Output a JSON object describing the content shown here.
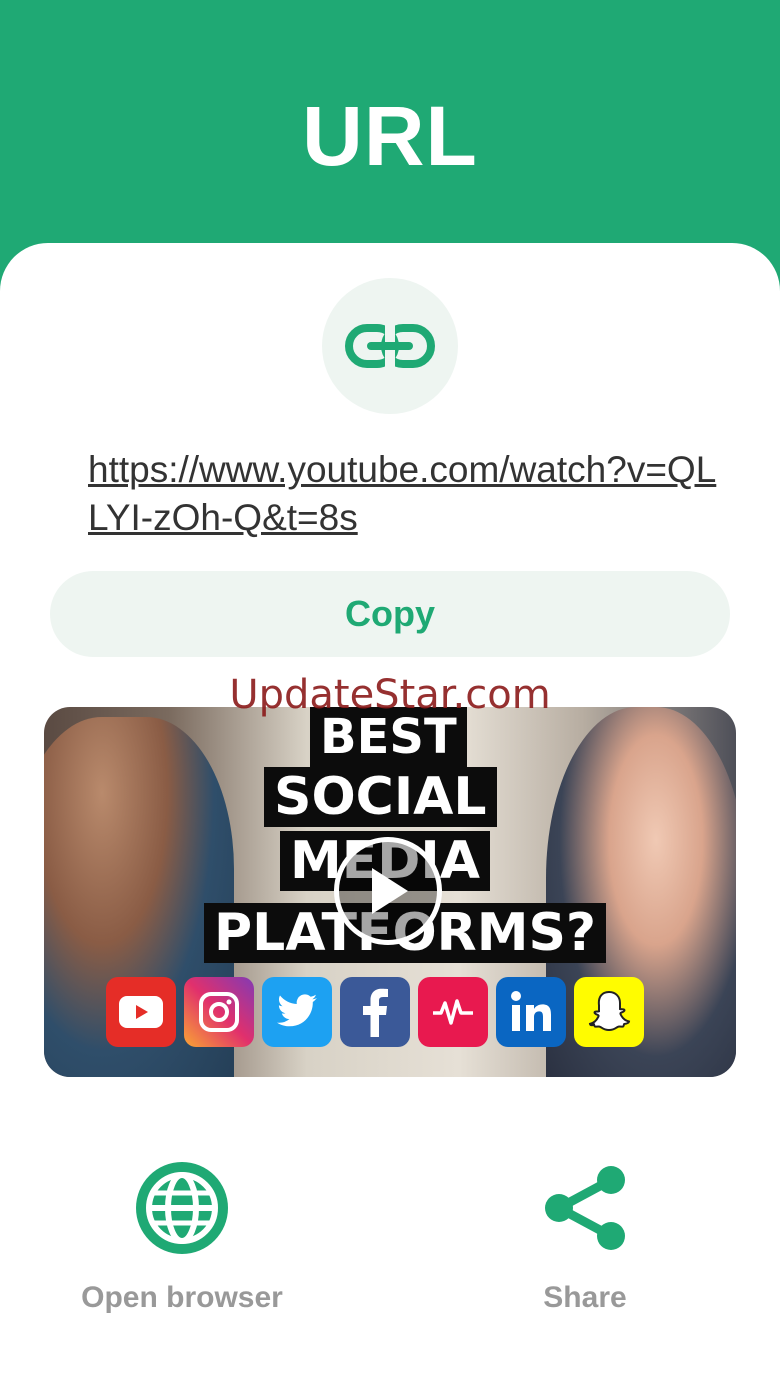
{
  "header": {
    "title": "URL"
  },
  "link": {
    "icon": "link-icon",
    "url": "https://www.youtube.com/watch?v=QLLYI-zOh-Q&t=8s"
  },
  "actions": {
    "copy_label": "Copy",
    "open_browser_label": "Open browser",
    "share_label": "Share"
  },
  "watermark": "UpdateStar.com",
  "thumbnail": {
    "lines": [
      "BEST",
      "SOCIAL",
      "MEDIA",
      "PLATFORMS?"
    ],
    "platform_icons": [
      "youtube",
      "instagram",
      "twitter",
      "facebook",
      "musically",
      "linkedin",
      "snapchat"
    ]
  },
  "colors": {
    "accent": "#1fa974",
    "button_bg": "#eef5f1",
    "label_gray": "#999999"
  }
}
